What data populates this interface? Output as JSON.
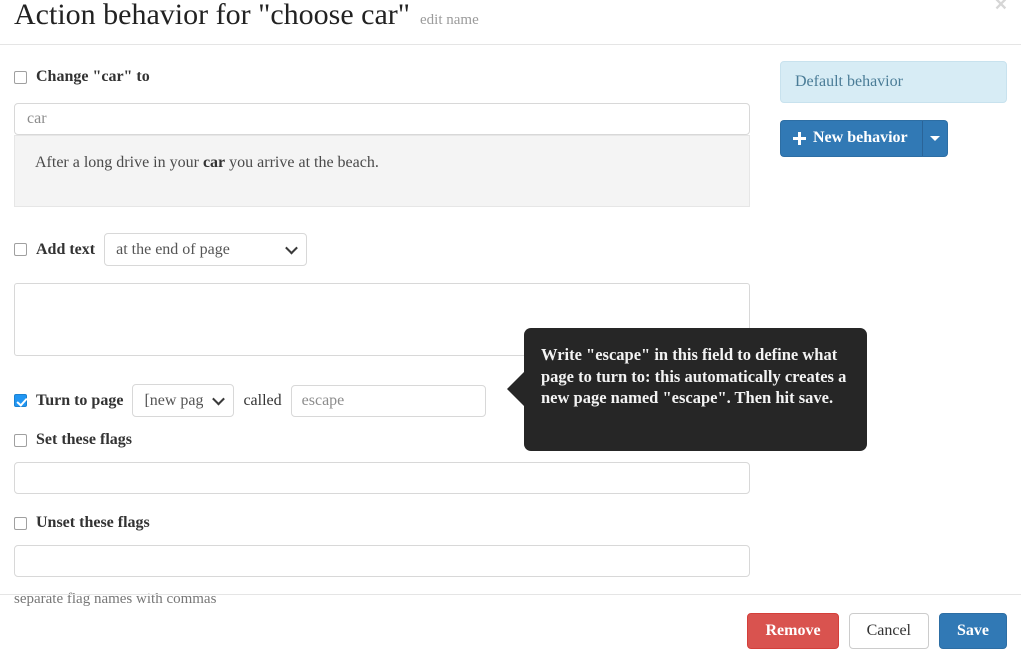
{
  "header": {
    "title": "Action behavior for \"choose car\"",
    "edit_name_label": "edit name",
    "close_icon": "close-icon",
    "close_glyph": "×"
  },
  "form": {
    "change_to": {
      "label": "Change \"car\" to",
      "checked": false,
      "input_value": "",
      "input_placeholder": "car"
    },
    "preview": {
      "before": "After a long drive in your ",
      "bold": "car",
      "after": " you arrive at the beach."
    },
    "add_text": {
      "label": "Add text",
      "checked": false,
      "select_value": "at the end of page",
      "select_options": [
        "at the end of page"
      ],
      "textarea_value": "",
      "textarea_placeholder": ""
    },
    "turn_to_page": {
      "label": "Turn to page",
      "checked": true,
      "page_select_value": "[new page]",
      "page_select_options": [
        "[new page]"
      ],
      "called_label": "called",
      "page_name_value": "",
      "page_name_placeholder": "escape"
    },
    "set_flags": {
      "label": "Set these flags",
      "checked": false,
      "input_value": "",
      "input_placeholder": ""
    },
    "unset_flags": {
      "label": "Unset these flags",
      "checked": false,
      "input_value": "",
      "input_placeholder": ""
    },
    "flags_hint": "separate flag names with commas"
  },
  "sidebar": {
    "behaviors": [
      {
        "label": "Default behavior",
        "selected": true
      }
    ],
    "new_behavior_label": "New behavior",
    "new_behavior_plus_icon": "plus-icon",
    "new_behavior_caret_icon": "caret-down-icon"
  },
  "tooltip": {
    "text": "Write \"escape\" in this field to define what page to turn to: this automatically creates a new page named \"escape\". Then hit save."
  },
  "footer": {
    "remove_label": "Remove",
    "cancel_label": "Cancel",
    "save_label": "Save"
  },
  "colors": {
    "primary_blue": "#3179b5",
    "danger_red": "#d9534f",
    "info_blue_bg": "#d7ecf5",
    "info_blue_text": "#4a7c97",
    "tooltip_bg": "#262626",
    "checkbox_checked": "#2196f3"
  }
}
